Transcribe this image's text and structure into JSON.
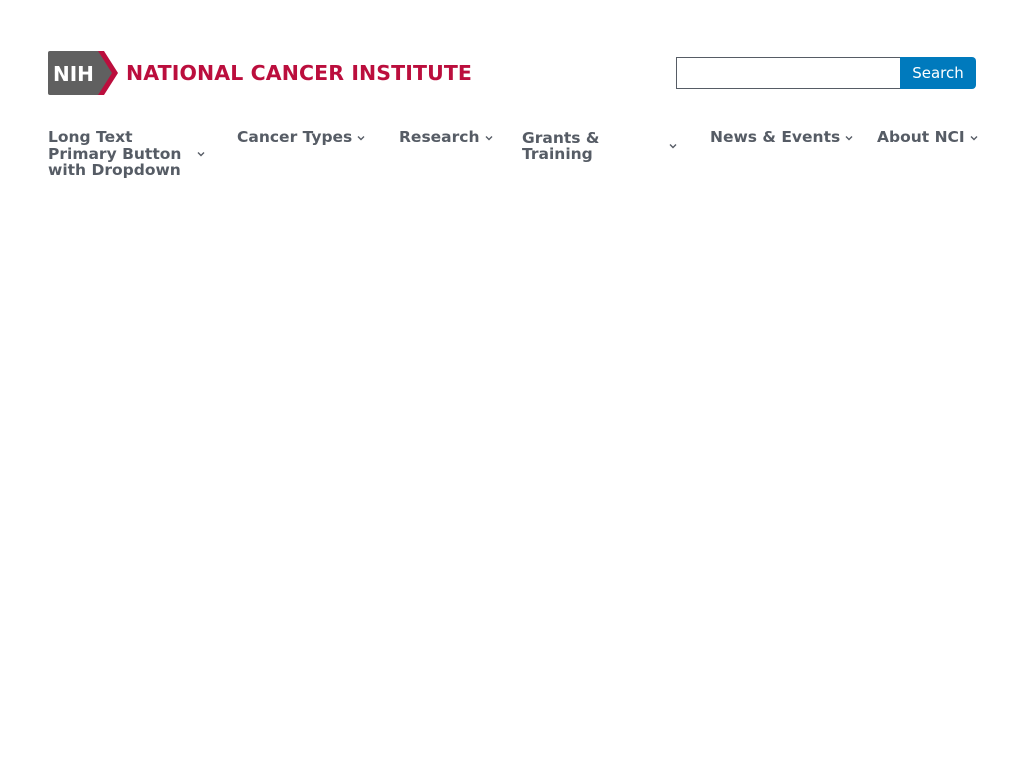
{
  "header": {
    "logo": {
      "badge_text": "NIH",
      "name": "NATIONAL CANCER INSTITUTE",
      "badge_color": "#606060",
      "name_color": "#bb0e3d"
    },
    "search": {
      "value": "",
      "placeholder": "",
      "button_label": "Search",
      "button_color": "#007abd"
    }
  },
  "nav": {
    "items": [
      {
        "label": "Long Text Primary Button with Dropdown",
        "icon": "chevron-down-icon"
      },
      {
        "label": "Cancer Types",
        "icon": "chevron-down-icon"
      },
      {
        "label": "Research",
        "icon": "chevron-down-icon"
      },
      {
        "label": "Grants & Training",
        "icon": "chevron-down-icon"
      },
      {
        "label": "News & Events",
        "icon": "chevron-down-icon"
      },
      {
        "label": "About NCI",
        "icon": "chevron-down-icon"
      }
    ],
    "text_color": "#565c65"
  }
}
